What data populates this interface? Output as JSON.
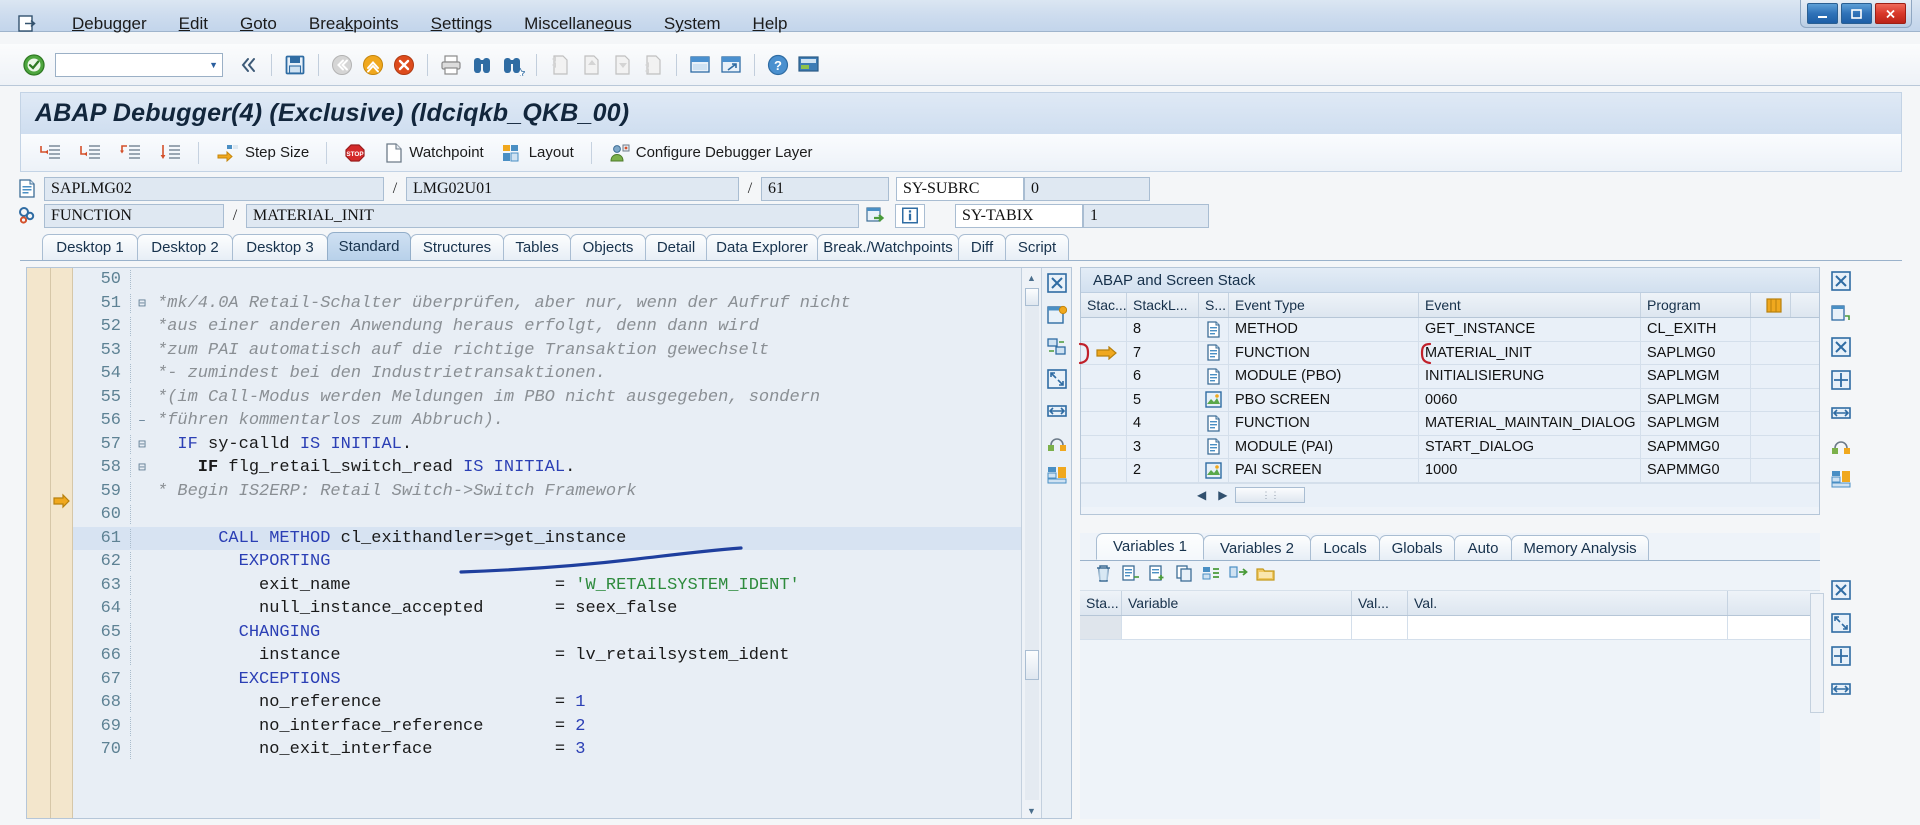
{
  "window": {
    "controls": [
      "minimize",
      "maximize",
      "close"
    ]
  },
  "menubar": {
    "system_icon": "sap-session-icon",
    "items": [
      {
        "label": "Debugger",
        "accel": "D"
      },
      {
        "label": "Edit",
        "accel": "E"
      },
      {
        "label": "Goto",
        "accel": "G"
      },
      {
        "label": "Breakpoints",
        "accel": "k"
      },
      {
        "label": "Settings",
        "accel": "S"
      },
      {
        "label": "Miscellaneous",
        "accel": "o"
      },
      {
        "label": "System",
        "accel": "y"
      },
      {
        "label": "Help",
        "accel": "H"
      }
    ]
  },
  "icontoolbar": {
    "command_field_value": "",
    "icons": [
      "enter-green-check-icon",
      "command-field",
      "back-double-arrow-icon",
      "save-icon",
      "back-icon",
      "exit-up-icon",
      "cancel-icon",
      "print-icon",
      "find-icon",
      "find-next-icon",
      "first-page-icon",
      "previous-page-icon",
      "next-page-icon",
      "last-page-icon",
      "create-session-icon",
      "create-shortcut-icon",
      "help-icon",
      "customize-local-layout-icon"
    ]
  },
  "screen": {
    "title": "ABAP Debugger(4)  (Exclusive) (ldciqkb_QKB_00)"
  },
  "apptoolbar": {
    "buttons": [
      {
        "label": "",
        "icon": "single-step-icon"
      },
      {
        "label": "",
        "icon": "execute-icon"
      },
      {
        "label": "",
        "icon": "return-icon"
      },
      {
        "label": "",
        "icon": "continue-icon"
      },
      {
        "label": "Step Size",
        "icon": "step-size-icon"
      },
      {
        "label": "",
        "icon": "breakpoint-stop-icon"
      },
      {
        "label": "Watchpoint",
        "icon": "watchpoint-page-icon"
      },
      {
        "label": "Layout",
        "icon": "layout-icon"
      },
      {
        "label": "Configure Debugger Layer",
        "icon": "configure-layer-icon"
      }
    ]
  },
  "fields": {
    "row1": {
      "icon": "program-icon",
      "program": "SAPLMG02",
      "separator": "/",
      "include": "LMG02U01",
      "separator2": "/",
      "line": "61",
      "sy_field_label": "SY-SUBRC",
      "sy_field_value": "0"
    },
    "row2": {
      "icon": "event-type-icon",
      "event_type": "FUNCTION",
      "separator": "/",
      "event_name": "MATERIAL_INIT",
      "icon_goto": "goto-source-icon",
      "icon_info": "info-icon",
      "sy_field_label": "SY-TABIX",
      "sy_field_value": "1"
    }
  },
  "tabs": {
    "active": "Standard",
    "items": [
      "Desktop 1",
      "Desktop 2",
      "Desktop 3",
      "Standard",
      "Structures",
      "Tables",
      "Objects",
      "Detail",
      "Data Explorer",
      "Break./Watchpoints",
      "Diff",
      "Script"
    ]
  },
  "code": {
    "current_line": 61,
    "lines": [
      {
        "n": "50",
        "fold": "",
        "tokens": [
          {
            "t": "",
            "c": "pl"
          }
        ]
      },
      {
        "n": "51",
        "fold": "⊟",
        "tokens": [
          {
            "t": "*mk/4.0A Retail-Schalter überprüfen, aber nur, wenn der Aufruf nicht",
            "c": "cmt"
          }
        ]
      },
      {
        "n": "52",
        "fold": "",
        "tokens": [
          {
            "t": "*aus einer anderen Anwendung heraus erfolgt, denn dann wird",
            "c": "cmt"
          }
        ]
      },
      {
        "n": "53",
        "fold": "",
        "tokens": [
          {
            "t": "*zum PAI automatisch auf die richtige Transaktion gewechselt",
            "c": "cmt"
          }
        ]
      },
      {
        "n": "54",
        "fold": "",
        "tokens": [
          {
            "t": "*- zumindest bei den Industrietransaktionen.",
            "c": "cmt"
          }
        ]
      },
      {
        "n": "55",
        "fold": "",
        "tokens": [
          {
            "t": "*(im Call-Modus werden Meldungen im PBO nicht ausgegeben, sondern",
            "c": "cmt"
          }
        ]
      },
      {
        "n": "56",
        "fold": "–",
        "tokens": [
          {
            "t": "*führen kommentarlos zum Abbruch).",
            "c": "cmt"
          }
        ]
      },
      {
        "n": "57",
        "fold": "⊟",
        "tokens": [
          {
            "t": "  IF ",
            "c": "k"
          },
          {
            "t": "sy-calld ",
            "c": "pl"
          },
          {
            "t": "IS INITIAL",
            "c": "k"
          },
          {
            "t": ".",
            "c": "pl"
          }
        ]
      },
      {
        "n": "58",
        "fold": "⊟",
        "tokens": [
          {
            "t": "    IF ",
            "c": "kb"
          },
          {
            "t": "flg_retail_switch_read ",
            "c": "pl"
          },
          {
            "t": "IS INITIAL",
            "c": "k"
          },
          {
            "t": ".",
            "c": "pl"
          }
        ]
      },
      {
        "n": "59",
        "fold": "",
        "tokens": [
          {
            "t": "* Begin IS2ERP: Retail Switch->Switch Framework",
            "c": "cmt"
          }
        ]
      },
      {
        "n": "60",
        "fold": "",
        "tokens": [
          {
            "t": "",
            "c": "pl"
          }
        ]
      },
      {
        "n": "61",
        "fold": "",
        "hl": true,
        "tokens": [
          {
            "t": "      CALL METHOD ",
            "c": "k"
          },
          {
            "t": "cl_exithandler=>get_instance",
            "c": "pl"
          }
        ]
      },
      {
        "n": "62",
        "fold": "",
        "tokens": [
          {
            "t": "        EXPORTING",
            "c": "k"
          }
        ]
      },
      {
        "n": "63",
        "fold": "",
        "tokens": [
          {
            "t": "          exit_name                    = ",
            "c": "pl"
          },
          {
            "t": "'W_RETAILSYSTEM_IDENT'",
            "c": "str"
          }
        ]
      },
      {
        "n": "64",
        "fold": "",
        "tokens": [
          {
            "t": "          null_instance_accepted       = seex_false",
            "c": "pl"
          }
        ]
      },
      {
        "n": "65",
        "fold": "",
        "tokens": [
          {
            "t": "        CHANGING",
            "c": "k"
          }
        ]
      },
      {
        "n": "66",
        "fold": "",
        "tokens": [
          {
            "t": "          instance                     = lv_retailsystem_ident",
            "c": "pl"
          }
        ]
      },
      {
        "n": "67",
        "fold": "",
        "tokens": [
          {
            "t": "        EXCEPTIONS",
            "c": "k"
          }
        ]
      },
      {
        "n": "68",
        "fold": "",
        "tokens": [
          {
            "t": "          no_reference                 = ",
            "c": "pl"
          },
          {
            "t": "1",
            "c": "num"
          }
        ]
      },
      {
        "n": "69",
        "fold": "",
        "tokens": [
          {
            "t": "          no_interface_reference       = ",
            "c": "pl"
          },
          {
            "t": "2",
            "c": "num"
          }
        ]
      },
      {
        "n": "70",
        "fold": "",
        "tokens": [
          {
            "t": "          no_exit_interface            = ",
            "c": "pl"
          },
          {
            "t": "3",
            "c": "num"
          }
        ]
      }
    ],
    "annotation": "blue-ink-underline-line64"
  },
  "stack_panel": {
    "title": "ABAP and Screen Stack",
    "columns": [
      "Stac...",
      "StackL...",
      "S...",
      "Event Type",
      "Event",
      "Program"
    ],
    "rows": [
      {
        "marker": "",
        "level": "8",
        "type_icon": "method-icon",
        "event_type": "METHOD",
        "event": "GET_INSTANCE",
        "program": "CL_EXITH"
      },
      {
        "marker": "current-position-arrow",
        "level": "7",
        "type_icon": "function-icon",
        "event_type": "FUNCTION",
        "event": "MATERIAL_INIT",
        "program": "SAPLMG0",
        "highlighted": true
      },
      {
        "marker": "",
        "level": "6",
        "type_icon": "module-icon",
        "event_type": "MODULE (PBO)",
        "event": "INITIALISIERUNG",
        "program": "SAPLMGM"
      },
      {
        "marker": "",
        "level": "5",
        "type_icon": "screen-icon",
        "event_type": "PBO SCREEN",
        "event": "0060",
        "program": "SAPLMGM"
      },
      {
        "marker": "",
        "level": "4",
        "type_icon": "function-icon",
        "event_type": "FUNCTION",
        "event": "MATERIAL_MAINTAIN_DIALOG",
        "program": "SAPLMGM"
      },
      {
        "marker": "",
        "level": "3",
        "type_icon": "module-icon",
        "event_type": "MODULE (PAI)",
        "event": "START_DIALOG",
        "program": "SAPMMG0"
      },
      {
        "marker": "",
        "level": "2",
        "type_icon": "screen-icon",
        "event_type": "PAI SCREEN",
        "event": "1000",
        "program": "SAPMMG0"
      }
    ],
    "hscroll": {
      "left_arrow": "◀",
      "right_arrow": "▶"
    }
  },
  "variables_panel": {
    "active_tab": "Variables 1",
    "tabs": [
      "Variables 1",
      "Variables 2",
      "Locals",
      "Globals",
      "Auto",
      "Memory Analysis"
    ],
    "toolbar_icons": [
      "delete-icon",
      "list-icon",
      "new-entry-icon",
      "copy-row-icon",
      "add-all-icon",
      "transfer-icon",
      "folder-icon"
    ],
    "columns": [
      "Sta...",
      "Variable",
      "Val...",
      "Val."
    ],
    "rows": [
      {
        "status": "",
        "variable": "",
        "val_short": "",
        "value": ""
      }
    ]
  },
  "colors": {
    "accent": "#2b5f9e",
    "keyword": "#2b3fb5",
    "comment": "#8a8f94",
    "string": "#2e8b3d",
    "highlight_row": "#d7e3f2",
    "gutter": "#f3e6cc",
    "annotation_ink": "#1f3f9e"
  }
}
